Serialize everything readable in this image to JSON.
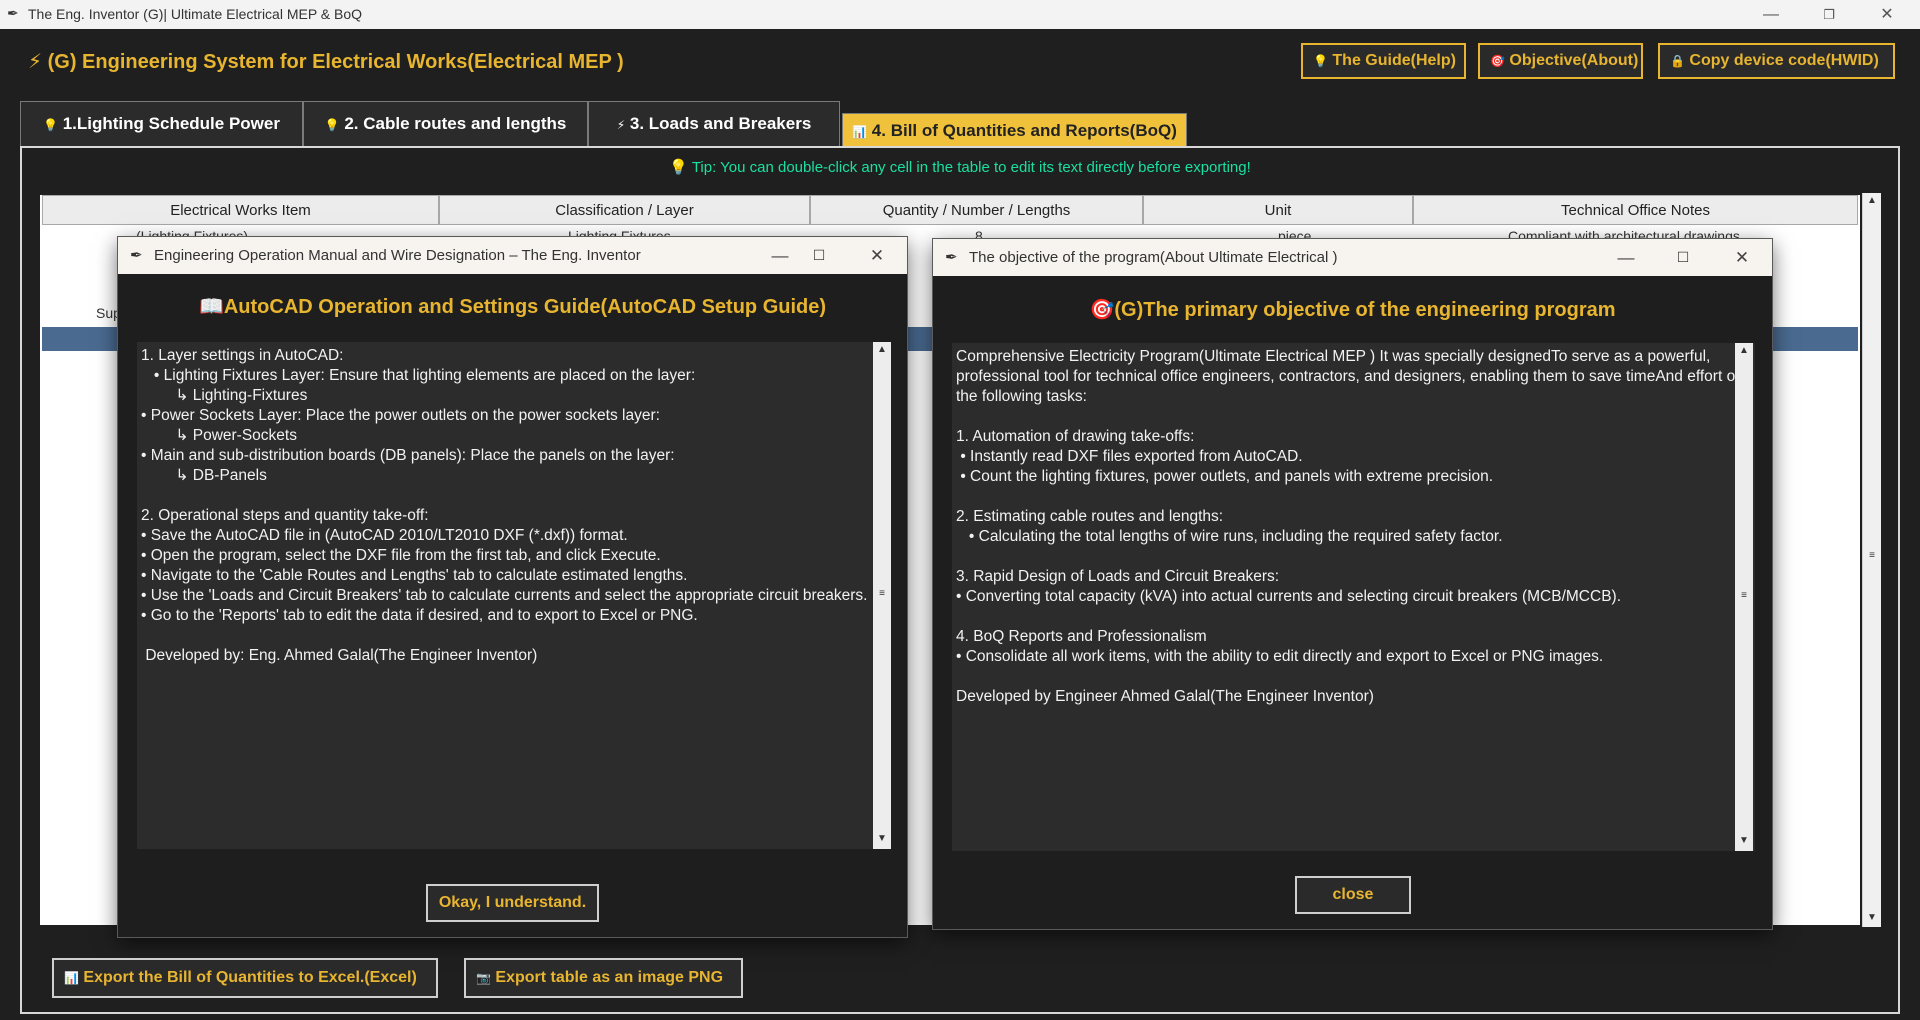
{
  "window": {
    "title": "The Eng. Inventor (G)| Ultimate Electrical MEP & BoQ",
    "minimize": "—",
    "maximize": "❐",
    "close": "✕"
  },
  "header": {
    "icon": "⚡",
    "title": "(G)  Engineering System for Electrical Works(Electrical MEP )",
    "buttons": [
      {
        "icon": "💡",
        "label": "The Guide(Help)"
      },
      {
        "icon": "🎯",
        "label": "Objective(About)"
      },
      {
        "icon": "🔒",
        "label": "Copy device code(HWID)"
      }
    ]
  },
  "tabs": [
    {
      "icon": "💡",
      "label": "1.Lighting Schedule Power"
    },
    {
      "icon": "💡",
      "label": "2. Cable routes and lengths"
    },
    {
      "icon": "⚡",
      "label": "3. Loads and Breakers"
    },
    {
      "icon": "📊",
      "label": "4. Bill of Quantities and Reports(BoQ)"
    }
  ],
  "tip": "💡 Tip: You can double-click any cell in the table to edit its text directly before exporting!",
  "table": {
    "columns": [
      "Electrical Works Item",
      "Classification / Layer",
      "Quantity / Number / Lengths",
      "Unit",
      "Technical Office Notes"
    ],
    "partial_rows": [
      [
        "(Lighting Fixtures)",
        "Lighting Fixtures",
        "8",
        "piece",
        "Compliant with architectural drawings"
      ]
    ],
    "side_fragment": "Sup"
  },
  "guide_dialog": {
    "title": "Engineering Operation Manual and Wire Designation – The Eng. Inventor",
    "heading": "📖AutoCAD Operation and Settings Guide(AutoCAD Setup Guide)",
    "body": "1. Layer settings in AutoCAD:\n   • Lighting Fixtures Layer: Ensure that lighting elements are placed on the layer:\n        ↳ Lighting-Fixtures\n• Power Sockets Layer: Place the power outlets on the power sockets layer:\n        ↳ Power-Sockets\n• Main and sub-distribution boards (DB panels): Place the panels on the layer:\n        ↳ DB-Panels\n\n2. Operational steps and quantity take-off:\n• Save the AutoCAD file in (AutoCAD 2010/LT2010 DXF (*.dxf)) format.\n• Open the program, select the DXF file from the first tab, and click Execute.\n• Navigate to the 'Cable Routes and Lengths' tab to calculate estimated lengths.\n• Use the 'Loads and Circuit Breakers' tab to calculate currents and select the appropriate circuit breakers.\n• Go to the 'Reports' tab to edit the data if desired, and to export to Excel or PNG.\n\n Developed by: Eng. Ahmed Galal(The Engineer Inventor)",
    "ok_button": "Okay, I understand."
  },
  "about_dialog": {
    "title": "The objective of the program(About Ultimate Electrical )",
    "heading": "🎯(G)The primary objective of the engineering program",
    "body": "Comprehensive Electricity Program(Ultimate Electrical MEP ) It was specially designedTo serve as a powerful, professional tool for technical office engineers, contractors, and designers, enabling them to save timeAnd effort on the following tasks:\n\n1. Automation of drawing take-offs:\n • Instantly read DXF files exported from AutoCAD.\n • Count the lighting fixtures, power outlets, and panels with extreme precision.\n\n2. Estimating cable routes and lengths:\n   • Calculating the total lengths of wire runs, including the required safety factor.\n\n3. Rapid Design of Loads and Circuit Breakers:\n• Converting total capacity (kVA) into actual currents and selecting circuit breakers (MCB/MCCB).\n\n4. BoQ Reports and Professionalism\n• Consolidate all work items, with the ability to edit directly and export to Excel or PNG images.\n\nDeveloped by Engineer Ahmed Galal(The Engineer Inventor)",
    "close_button": "close"
  },
  "export": {
    "excel": {
      "icon": "📊",
      "label": "Export the Bill of Quantities to Excel.(Excel)"
    },
    "png": {
      "icon": "📷",
      "label": "Export table as an image PNG"
    }
  },
  "colors": {
    "accent": "#e8b530",
    "tip": "#19e0a0",
    "background": "#1f1f1f",
    "selection": "#4a6a90"
  }
}
